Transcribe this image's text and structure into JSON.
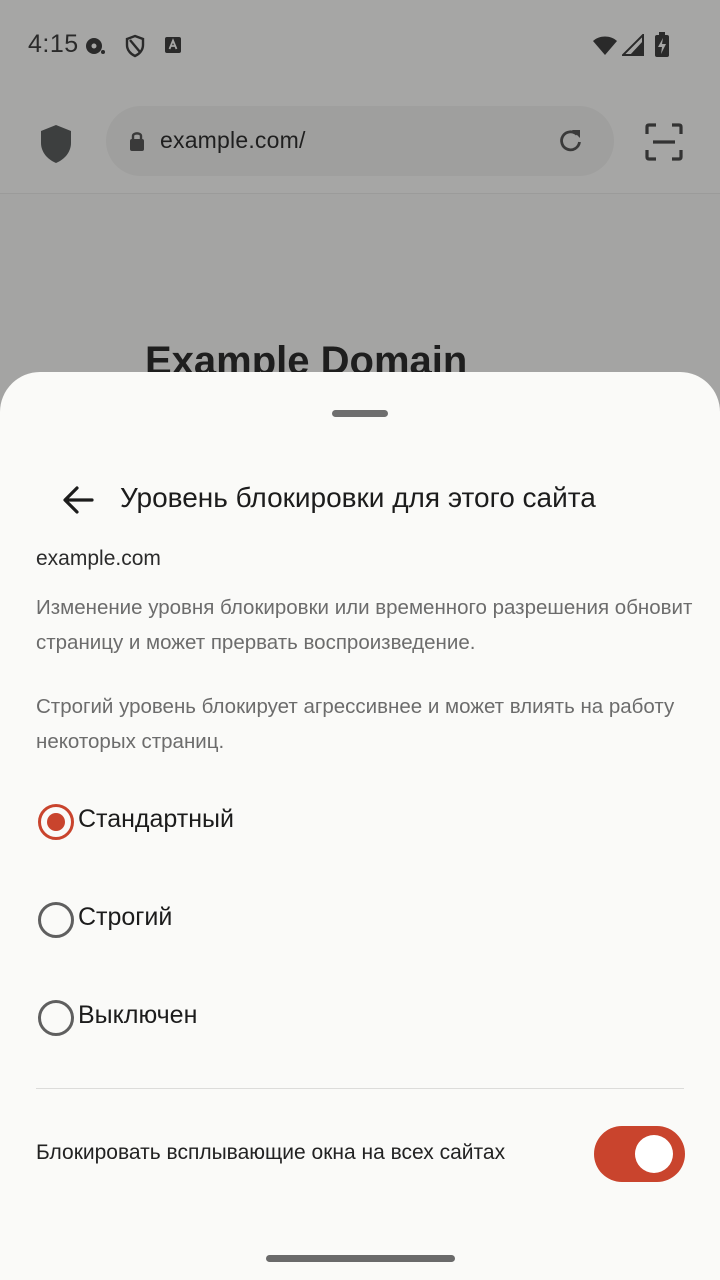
{
  "status_bar": {
    "time": "4:15",
    "icons": [
      "media-icon",
      "shield-status-icon",
      "translate-icon",
      "wifi-icon",
      "signal-icon",
      "battery-charging-icon"
    ]
  },
  "toolbar": {
    "url": "example.com/",
    "icons": [
      "shield-icon",
      "lock-icon",
      "reload-icon",
      "scan-icon"
    ]
  },
  "page": {
    "title": "Example Domain"
  },
  "sheet": {
    "title": "Уровень блокировки для этого сайта",
    "site": "example.com",
    "description_1": "Изменение уровня блокировки или временного разрешения обновит страницу и может прервать воспроизведение.",
    "description_2": "Строгий уровень блокирует агрессивнее и может влиять на работу некоторых страниц.",
    "options": [
      {
        "label": "Стандартный",
        "selected": true
      },
      {
        "label": "Строгий",
        "selected": false
      },
      {
        "label": "Выключен",
        "selected": false
      }
    ],
    "popup_setting": {
      "label": "Блокировать всплывающие окна на всех сайтах",
      "enabled": true
    }
  },
  "colors": {
    "accent": "#c9442d",
    "sheet_background": "#fafaf8",
    "scrim": "#a6a6a5"
  }
}
